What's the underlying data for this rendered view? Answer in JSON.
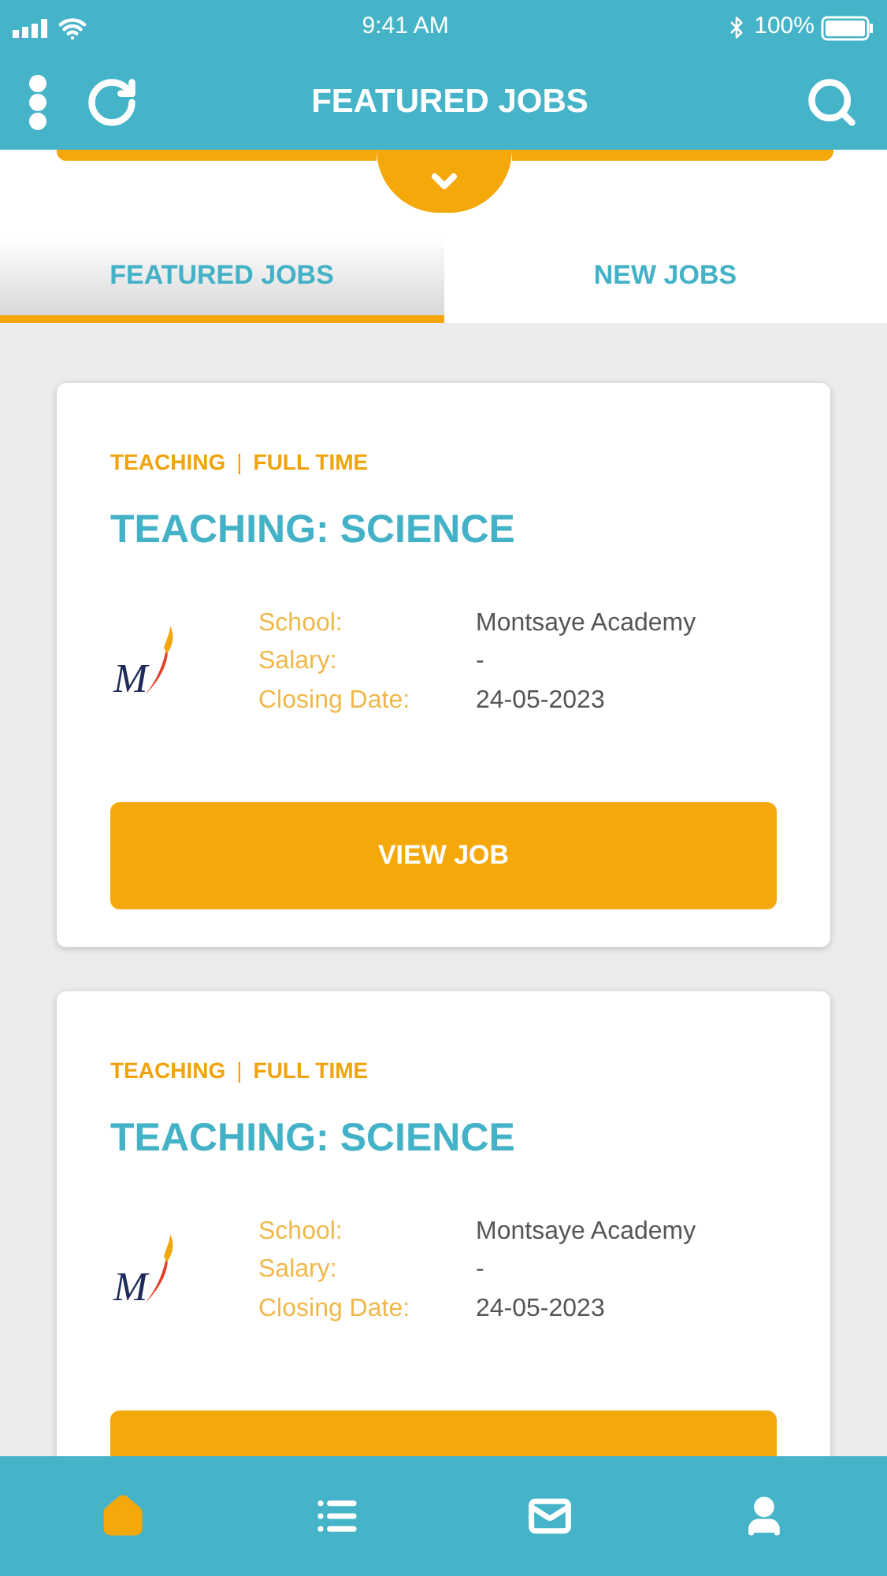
{
  "status_bar": {
    "time": "9:41 AM",
    "battery": "100%"
  },
  "header": {
    "title": "FEATURED JOBS"
  },
  "tabs": [
    {
      "label": "FEATURED JOBS",
      "selected": true
    },
    {
      "label": "NEW JOBS",
      "selected": false
    }
  ],
  "jobs": [
    {
      "tags": [
        "TEACHING",
        "|",
        "FULL TIME"
      ],
      "title": "TEACHING: SCIENCE",
      "logo_text": "M",
      "details": [
        {
          "label": "School:",
          "value": "Montsaye Academy"
        },
        {
          "label": "Salary:",
          "value": "-"
        },
        {
          "label": "Closing Date:",
          "value": "24-05-2023"
        }
      ],
      "button": "VIEW JOB"
    },
    {
      "tags": [
        "TEACHING",
        "|",
        "FULL TIME"
      ],
      "title": "TEACHING: SCIENCE",
      "logo_text": "M",
      "details": [
        {
          "label": "School:",
          "value": "Montsaye Academy"
        },
        {
          "label": "Salary:",
          "value": "-"
        },
        {
          "label": "Closing Date:",
          "value": "24-05-2023"
        }
      ]
    }
  ],
  "bottom_nav": [
    {
      "kind": "home",
      "selected": true
    },
    {
      "kind": "list",
      "selected": false
    },
    {
      "kind": "mail",
      "selected": false
    },
    {
      "kind": "profile",
      "selected": false
    }
  ]
}
